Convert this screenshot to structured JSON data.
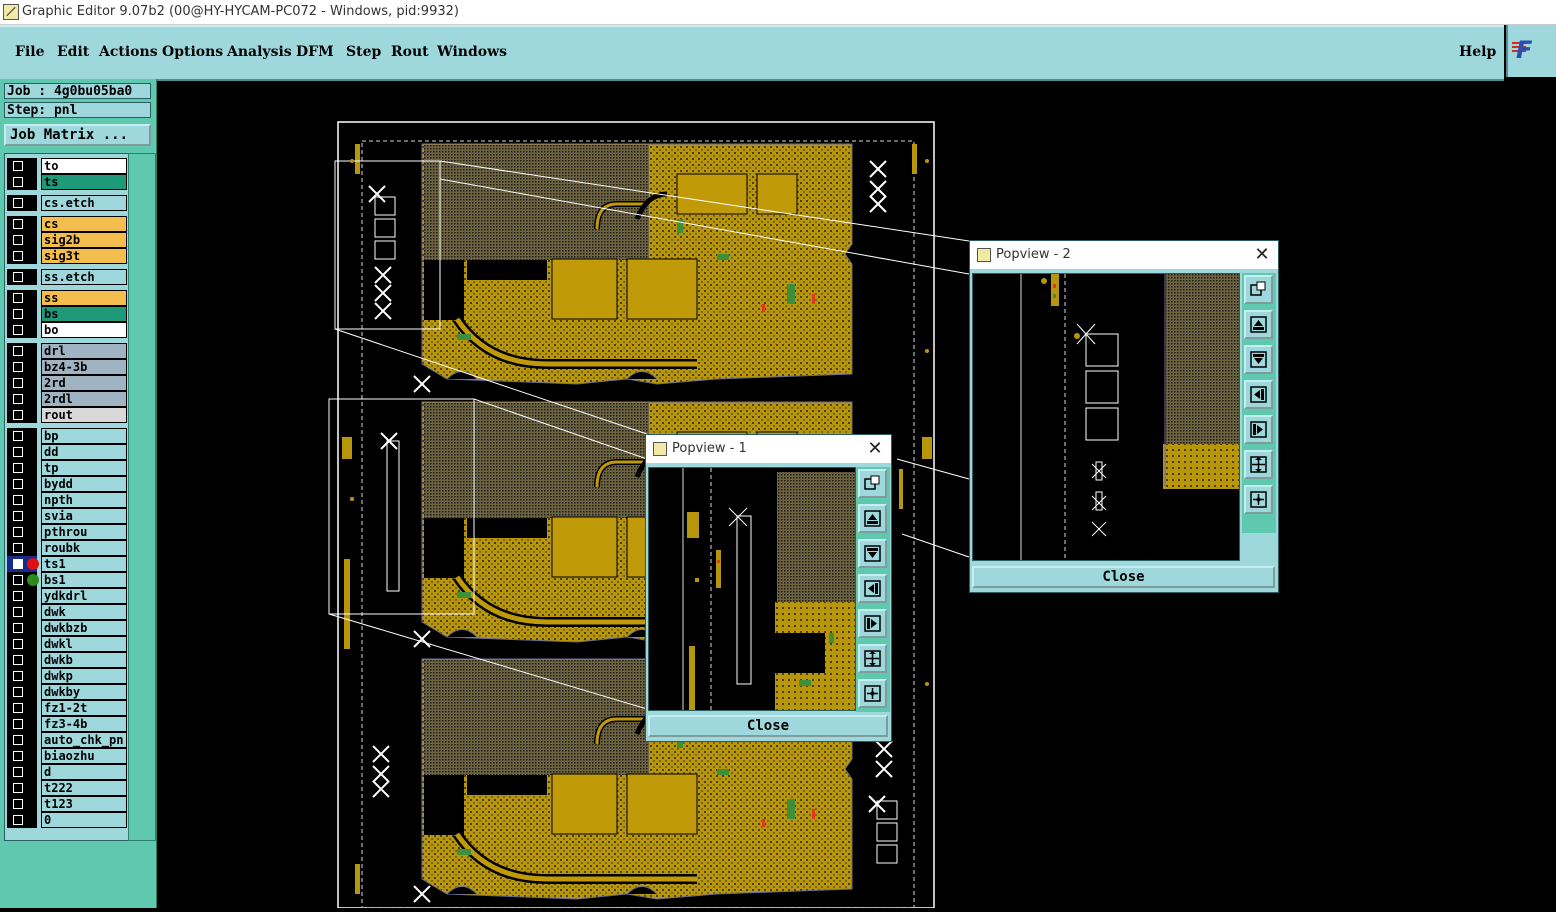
{
  "window": {
    "title": "Graphic Editor 9.07b2 (00@HY-HYCAM-PC072 - Windows, pid:9932)"
  },
  "menu": {
    "items": [
      "File",
      "Edit",
      "Actions",
      "Options",
      "Analysis",
      "DFM",
      "Step",
      "Rout",
      "Windows"
    ],
    "help": "Help"
  },
  "brand": {
    "text": "F"
  },
  "job": {
    "job_label": "Job : 4g0bu05ba0",
    "step_label": "Step: pnl",
    "matrix_button": "Job Matrix ..."
  },
  "layers": [
    {
      "name": "to",
      "bg": "#ffffff"
    },
    {
      "name": "ts",
      "bg": "#1f9a78"
    },
    {
      "name": "cs.etch",
      "bg": "#9ed8dc"
    },
    {
      "name": "cs",
      "bg": "#f4be4e"
    },
    {
      "name": "sig2b",
      "bg": "#f4be4e"
    },
    {
      "name": "sig3t",
      "bg": "#f4be4e"
    },
    {
      "name": "ss.etch",
      "bg": "#9ed8dc"
    },
    {
      "name": "ss",
      "bg": "#f4be4e"
    },
    {
      "name": "bs",
      "bg": "#1f9a78"
    },
    {
      "name": "bo",
      "bg": "#ffffff"
    },
    {
      "name": "drl",
      "bg": "#9fb3c2"
    },
    {
      "name": "bz4-3b",
      "bg": "#9fb3c2"
    },
    {
      "name": "2rd",
      "bg": "#9fb3c2"
    },
    {
      "name": "2rdl",
      "bg": "#9fb3c2"
    },
    {
      "name": "rout",
      "bg": "#d8d8d8"
    },
    {
      "name": "bp",
      "bg": "#9ed8dc"
    },
    {
      "name": "dd",
      "bg": "#9ed8dc"
    },
    {
      "name": "tp",
      "bg": "#9ed8dc"
    },
    {
      "name": "bydd",
      "bg": "#9ed8dc"
    },
    {
      "name": "npth",
      "bg": "#9ed8dc"
    },
    {
      "name": "svia",
      "bg": "#9ed8dc"
    },
    {
      "name": "pthrou",
      "bg": "#9ed8dc"
    },
    {
      "name": "roubk",
      "bg": "#9ed8dc"
    },
    {
      "name": "ts1",
      "bg": "#9ed8dc",
      "dot": "#e01010",
      "selected": true
    },
    {
      "name": "bs1",
      "bg": "#9ed8dc",
      "dot": "#2d8a1c"
    },
    {
      "name": "ydkdrl",
      "bg": "#9ed8dc"
    },
    {
      "name": "dwk",
      "bg": "#9ed8dc"
    },
    {
      "name": "dwkbzb",
      "bg": "#9ed8dc"
    },
    {
      "name": "dwkl",
      "bg": "#9ed8dc"
    },
    {
      "name": "dwkb",
      "bg": "#9ed8dc"
    },
    {
      "name": "dwkp",
      "bg": "#9ed8dc"
    },
    {
      "name": "dwkby",
      "bg": "#9ed8dc"
    },
    {
      "name": "fz1-2t",
      "bg": "#9ed8dc"
    },
    {
      "name": "fz3-4b",
      "bg": "#9ed8dc"
    },
    {
      "name": "auto_chk_pn",
      "bg": "#9ed8dc"
    },
    {
      "name": "biaozhu",
      "bg": "#9ed8dc"
    },
    {
      "name": "d",
      "bg": "#9ed8dc"
    },
    {
      "name": "t222",
      "bg": "#9ed8dc"
    },
    {
      "name": "t123",
      "bg": "#9ed8dc"
    },
    {
      "name": "0",
      "bg": "#9ed8dc"
    }
  ],
  "popview1": {
    "title": "Popview - 1",
    "close": "Close"
  },
  "popview2": {
    "title": "Popview - 2",
    "close": "Close"
  },
  "colors": {
    "copper": "#b8960c",
    "panel": "#9ed8dc",
    "bg": "#000000"
  }
}
